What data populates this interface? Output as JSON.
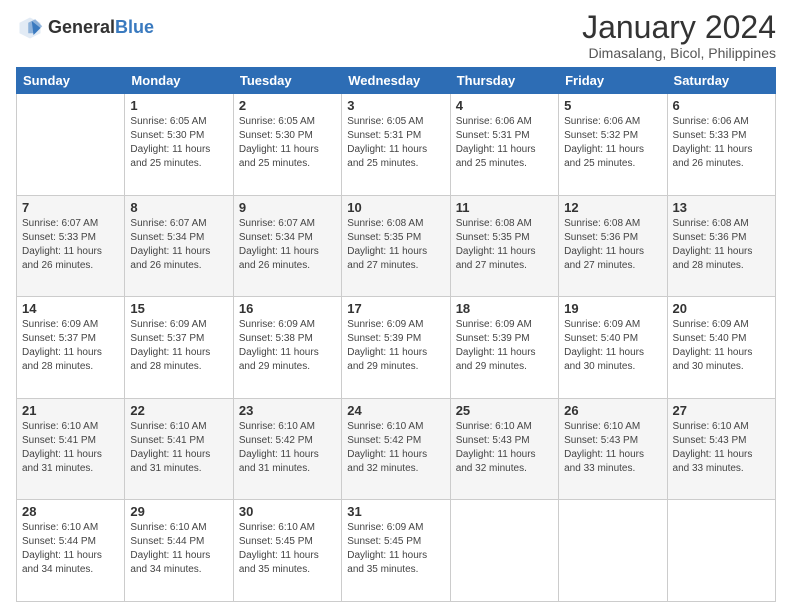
{
  "logo": {
    "general": "General",
    "blue": "Blue"
  },
  "title": "January 2024",
  "subtitle": "Dimasalang, Bicol, Philippines",
  "header": {
    "days": [
      "Sunday",
      "Monday",
      "Tuesday",
      "Wednesday",
      "Thursday",
      "Friday",
      "Saturday"
    ]
  },
  "weeks": [
    [
      {
        "day": "",
        "sunrise": "",
        "sunset": "",
        "daylight": ""
      },
      {
        "day": "1",
        "sunrise": "Sunrise: 6:05 AM",
        "sunset": "Sunset: 5:30 PM",
        "daylight": "Daylight: 11 hours and 25 minutes."
      },
      {
        "day": "2",
        "sunrise": "Sunrise: 6:05 AM",
        "sunset": "Sunset: 5:30 PM",
        "daylight": "Daylight: 11 hours and 25 minutes."
      },
      {
        "day": "3",
        "sunrise": "Sunrise: 6:05 AM",
        "sunset": "Sunset: 5:31 PM",
        "daylight": "Daylight: 11 hours and 25 minutes."
      },
      {
        "day": "4",
        "sunrise": "Sunrise: 6:06 AM",
        "sunset": "Sunset: 5:31 PM",
        "daylight": "Daylight: 11 hours and 25 minutes."
      },
      {
        "day": "5",
        "sunrise": "Sunrise: 6:06 AM",
        "sunset": "Sunset: 5:32 PM",
        "daylight": "Daylight: 11 hours and 25 minutes."
      },
      {
        "day": "6",
        "sunrise": "Sunrise: 6:06 AM",
        "sunset": "Sunset: 5:33 PM",
        "daylight": "Daylight: 11 hours and 26 minutes."
      }
    ],
    [
      {
        "day": "7",
        "sunrise": "Sunrise: 6:07 AM",
        "sunset": "Sunset: 5:33 PM",
        "daylight": "Daylight: 11 hours and 26 minutes."
      },
      {
        "day": "8",
        "sunrise": "Sunrise: 6:07 AM",
        "sunset": "Sunset: 5:34 PM",
        "daylight": "Daylight: 11 hours and 26 minutes."
      },
      {
        "day": "9",
        "sunrise": "Sunrise: 6:07 AM",
        "sunset": "Sunset: 5:34 PM",
        "daylight": "Daylight: 11 hours and 26 minutes."
      },
      {
        "day": "10",
        "sunrise": "Sunrise: 6:08 AM",
        "sunset": "Sunset: 5:35 PM",
        "daylight": "Daylight: 11 hours and 27 minutes."
      },
      {
        "day": "11",
        "sunrise": "Sunrise: 6:08 AM",
        "sunset": "Sunset: 5:35 PM",
        "daylight": "Daylight: 11 hours and 27 minutes."
      },
      {
        "day": "12",
        "sunrise": "Sunrise: 6:08 AM",
        "sunset": "Sunset: 5:36 PM",
        "daylight": "Daylight: 11 hours and 27 minutes."
      },
      {
        "day": "13",
        "sunrise": "Sunrise: 6:08 AM",
        "sunset": "Sunset: 5:36 PM",
        "daylight": "Daylight: 11 hours and 28 minutes."
      }
    ],
    [
      {
        "day": "14",
        "sunrise": "Sunrise: 6:09 AM",
        "sunset": "Sunset: 5:37 PM",
        "daylight": "Daylight: 11 hours and 28 minutes."
      },
      {
        "day": "15",
        "sunrise": "Sunrise: 6:09 AM",
        "sunset": "Sunset: 5:37 PM",
        "daylight": "Daylight: 11 hours and 28 minutes."
      },
      {
        "day": "16",
        "sunrise": "Sunrise: 6:09 AM",
        "sunset": "Sunset: 5:38 PM",
        "daylight": "Daylight: 11 hours and 29 minutes."
      },
      {
        "day": "17",
        "sunrise": "Sunrise: 6:09 AM",
        "sunset": "Sunset: 5:39 PM",
        "daylight": "Daylight: 11 hours and 29 minutes."
      },
      {
        "day": "18",
        "sunrise": "Sunrise: 6:09 AM",
        "sunset": "Sunset: 5:39 PM",
        "daylight": "Daylight: 11 hours and 29 minutes."
      },
      {
        "day": "19",
        "sunrise": "Sunrise: 6:09 AM",
        "sunset": "Sunset: 5:40 PM",
        "daylight": "Daylight: 11 hours and 30 minutes."
      },
      {
        "day": "20",
        "sunrise": "Sunrise: 6:09 AM",
        "sunset": "Sunset: 5:40 PM",
        "daylight": "Daylight: 11 hours and 30 minutes."
      }
    ],
    [
      {
        "day": "21",
        "sunrise": "Sunrise: 6:10 AM",
        "sunset": "Sunset: 5:41 PM",
        "daylight": "Daylight: 11 hours and 31 minutes."
      },
      {
        "day": "22",
        "sunrise": "Sunrise: 6:10 AM",
        "sunset": "Sunset: 5:41 PM",
        "daylight": "Daylight: 11 hours and 31 minutes."
      },
      {
        "day": "23",
        "sunrise": "Sunrise: 6:10 AM",
        "sunset": "Sunset: 5:42 PM",
        "daylight": "Daylight: 11 hours and 31 minutes."
      },
      {
        "day": "24",
        "sunrise": "Sunrise: 6:10 AM",
        "sunset": "Sunset: 5:42 PM",
        "daylight": "Daylight: 11 hours and 32 minutes."
      },
      {
        "day": "25",
        "sunrise": "Sunrise: 6:10 AM",
        "sunset": "Sunset: 5:43 PM",
        "daylight": "Daylight: 11 hours and 32 minutes."
      },
      {
        "day": "26",
        "sunrise": "Sunrise: 6:10 AM",
        "sunset": "Sunset: 5:43 PM",
        "daylight": "Daylight: 11 hours and 33 minutes."
      },
      {
        "day": "27",
        "sunrise": "Sunrise: 6:10 AM",
        "sunset": "Sunset: 5:43 PM",
        "daylight": "Daylight: 11 hours and 33 minutes."
      }
    ],
    [
      {
        "day": "28",
        "sunrise": "Sunrise: 6:10 AM",
        "sunset": "Sunset: 5:44 PM",
        "daylight": "Daylight: 11 hours and 34 minutes."
      },
      {
        "day": "29",
        "sunrise": "Sunrise: 6:10 AM",
        "sunset": "Sunset: 5:44 PM",
        "daylight": "Daylight: 11 hours and 34 minutes."
      },
      {
        "day": "30",
        "sunrise": "Sunrise: 6:10 AM",
        "sunset": "Sunset: 5:45 PM",
        "daylight": "Daylight: 11 hours and 35 minutes."
      },
      {
        "day": "31",
        "sunrise": "Sunrise: 6:09 AM",
        "sunset": "Sunset: 5:45 PM",
        "daylight": "Daylight: 11 hours and 35 minutes."
      },
      {
        "day": "",
        "sunrise": "",
        "sunset": "",
        "daylight": ""
      },
      {
        "day": "",
        "sunrise": "",
        "sunset": "",
        "daylight": ""
      },
      {
        "day": "",
        "sunrise": "",
        "sunset": "",
        "daylight": ""
      }
    ]
  ]
}
